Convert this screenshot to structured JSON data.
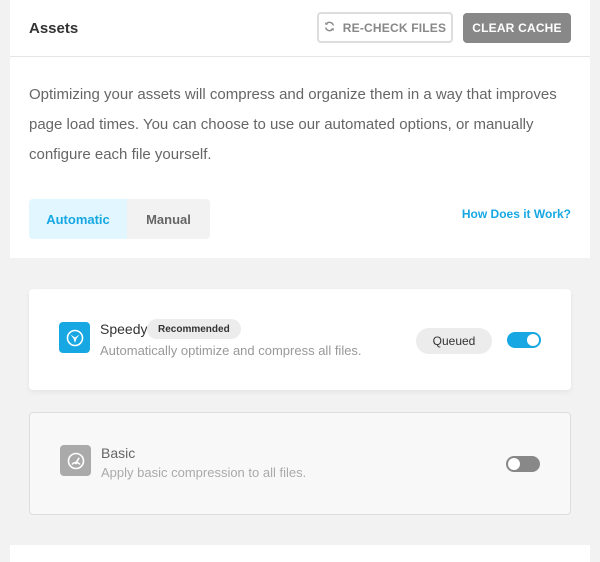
{
  "header": {
    "title": "Assets",
    "recheck_label": "RE-CHECK FILES",
    "clear_label": "CLEAR CACHE"
  },
  "description": "Optimizing your assets will compress and organize them in a way that improves page load times. You can choose to use our automated options, or manually configure each file yourself.",
  "tabs": [
    {
      "label": "Automatic",
      "active": true
    },
    {
      "label": "Manual",
      "active": false
    }
  ],
  "help_link": "How Does it Work?",
  "options": {
    "speedy": {
      "name": "Speedy",
      "badge": "Recommended",
      "description": "Automatically optimize and compress all files.",
      "status": "Queued",
      "enabled": true,
      "icon": "speedy-icon"
    },
    "basic": {
      "name": "Basic",
      "description": "Apply basic compression to all files.",
      "enabled": false,
      "icon": "gauge-icon"
    }
  },
  "colors": {
    "accent": "#17a8e3",
    "muted_button": "#888888",
    "tab_active_bg": "#e1f6ff",
    "page_bg": "#f2f2f2"
  }
}
